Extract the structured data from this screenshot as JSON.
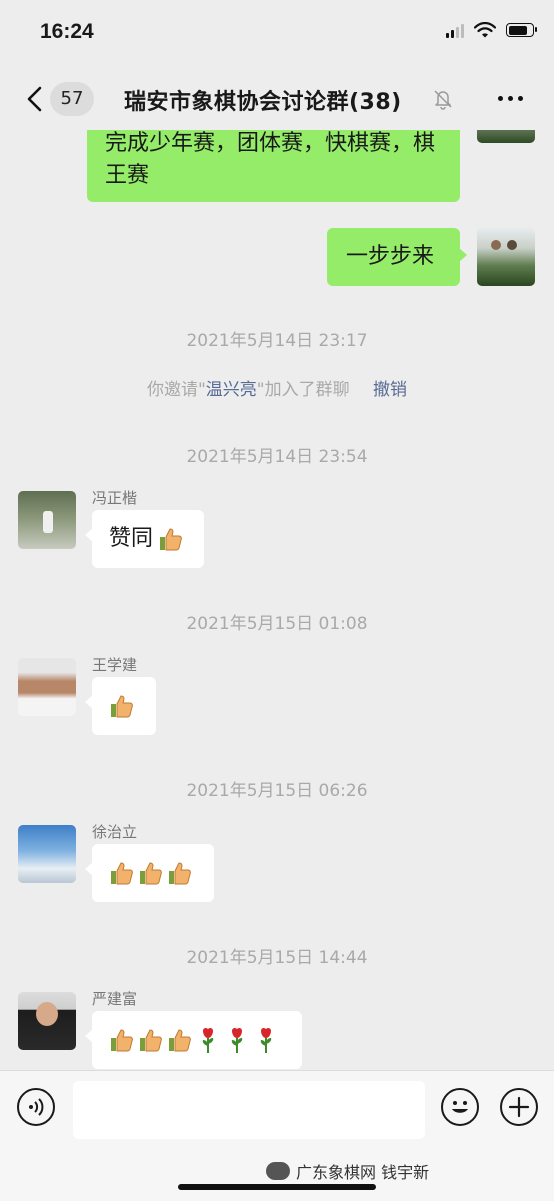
{
  "status_bar": {
    "time": "16:24"
  },
  "nav": {
    "unread_count": "57",
    "title": "瑞安市象棋协会讨论群(38)"
  },
  "messages": {
    "m1": {
      "text": "完成少年赛，团体赛，快棋赛，棋王赛"
    },
    "m2": {
      "text": "一步步来"
    },
    "ts1": "2021年5月14日 23:17",
    "sys": {
      "pre": "你邀请\"",
      "name": "温兴亮",
      "post": "\"加入了群聊",
      "undo": "撤销"
    },
    "ts2": "2021年5月14日 23:54",
    "m3": {
      "sender": "冯正楷",
      "text": "赞同"
    },
    "ts3": "2021年5月15日 01:08",
    "m4": {
      "sender": "王学建"
    },
    "ts4": "2021年5月15日 06:26",
    "m5": {
      "sender": "徐治立"
    },
    "ts5": "2021年5月15日 14:44",
    "m6": {
      "sender": "严建富"
    }
  },
  "watermark": {
    "text": "广东象棋网 钱宇新"
  },
  "colors": {
    "my_bubble": "#95ec69",
    "other_bubble": "#ffffff",
    "link": "#576b95",
    "background": "#ededed"
  },
  "icons": [
    "back-icon",
    "mute-bell-icon",
    "more-icon",
    "thumbs-up-icon",
    "rose-icon",
    "voice-icon",
    "emoji-icon",
    "plus-icon",
    "wechat-logo-icon"
  ]
}
